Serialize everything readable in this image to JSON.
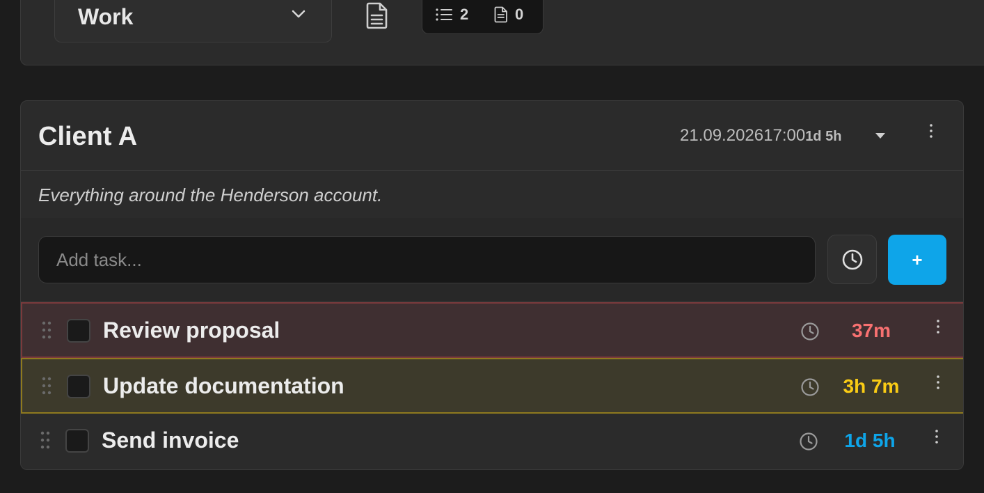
{
  "top": {
    "list_select_value": "Work",
    "counter_tasks": "2",
    "counter_notes": "0"
  },
  "card": {
    "title": "Client A",
    "due_date": "21.09.202617:00",
    "due_relative": "1d 5h",
    "description": "Everything around the Henderson account.",
    "add_task_placeholder": "Add task...",
    "add_button_label": "+",
    "tasks": [
      {
        "title": "Review proposal",
        "time_left": "37m",
        "status": "overdue",
        "color": "#f87171"
      },
      {
        "title": "Update documentation",
        "time_left": "3h 7m",
        "status": "soon",
        "color": "#facc15"
      },
      {
        "title": "Send invoice",
        "time_left": "1d 5h",
        "status": "later",
        "color": "#0ea5e9"
      }
    ]
  },
  "colors": {
    "accent": "#0ea5e9",
    "overdue": "#f87171",
    "soon": "#facc15"
  }
}
